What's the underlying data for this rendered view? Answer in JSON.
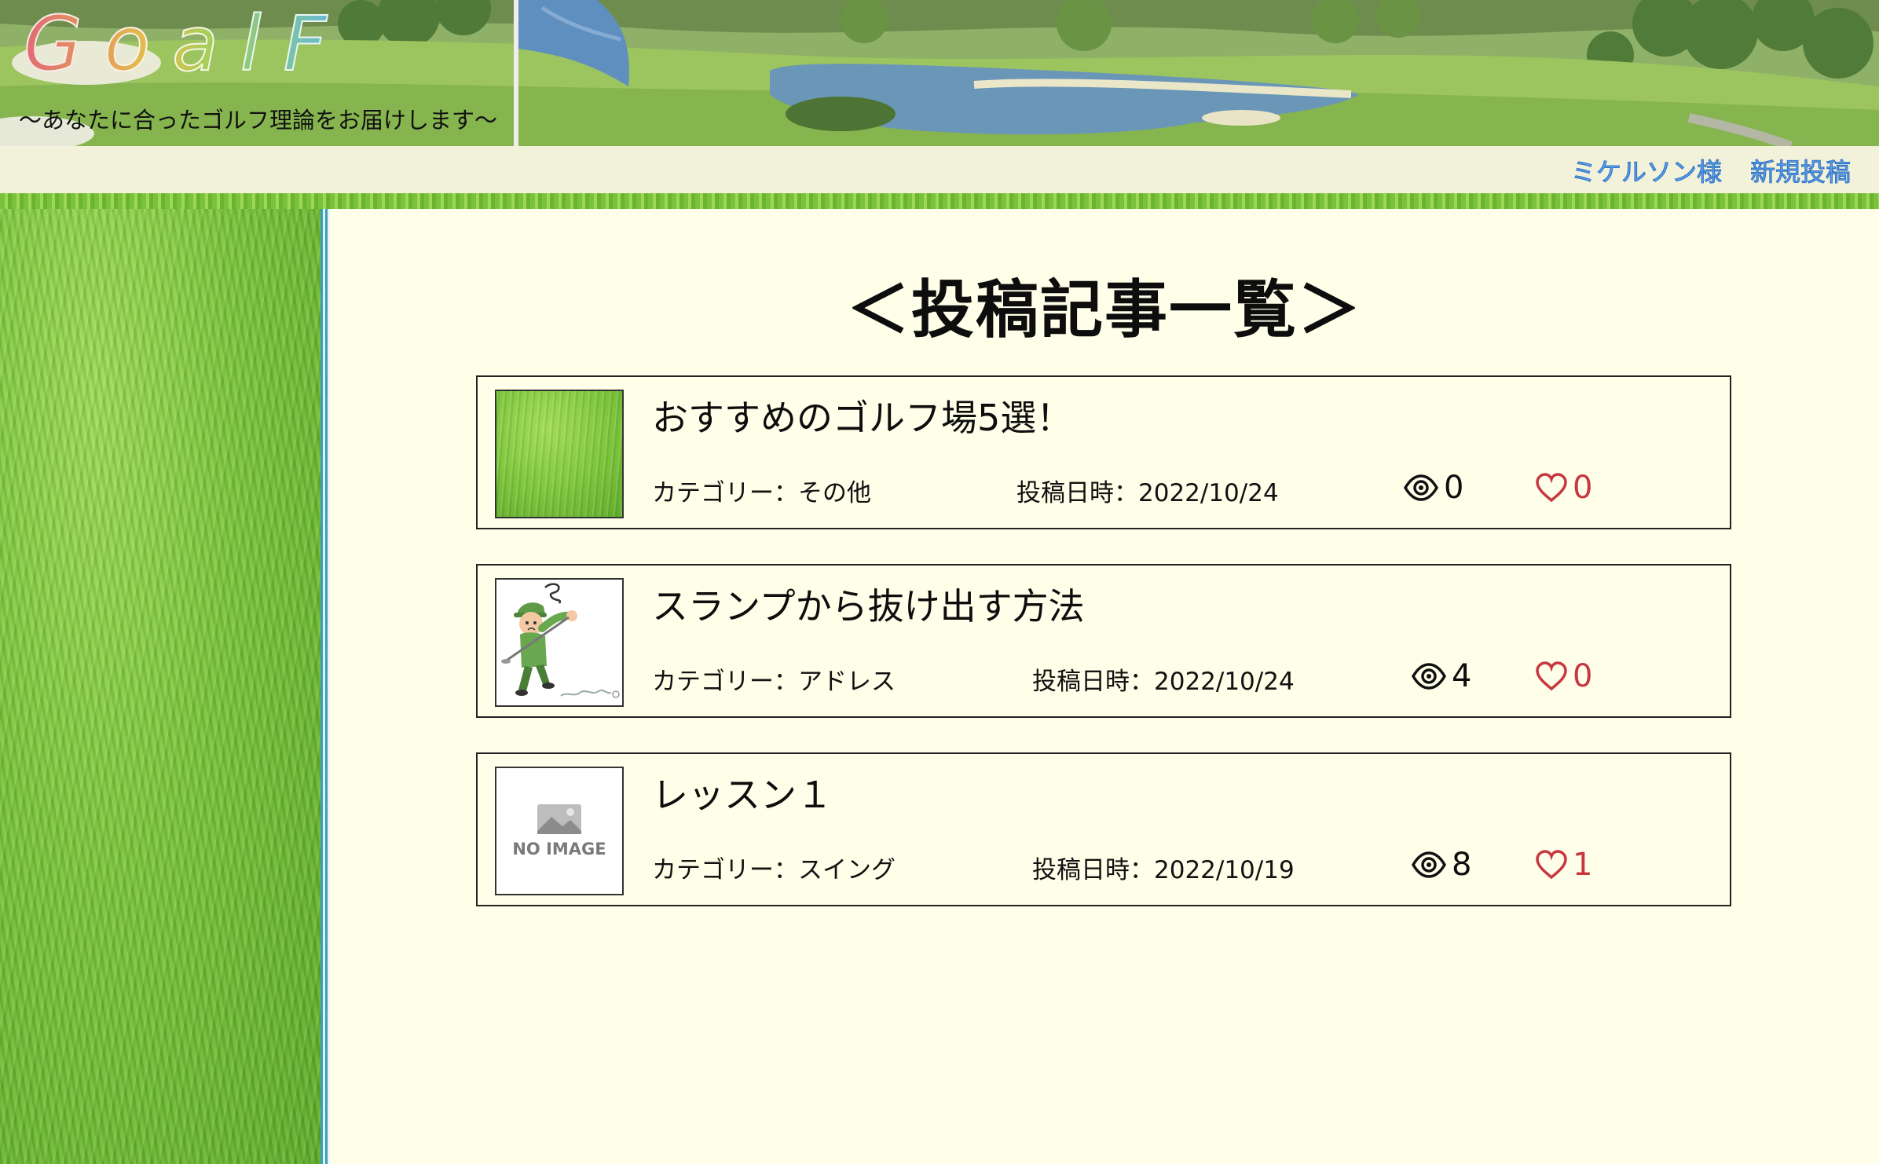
{
  "header": {
    "logo": "GoalF",
    "tagline": "〜あなたに合ったゴルフ理論をお届けします〜"
  },
  "nav": {
    "user_link": "ミケルソン様",
    "new_post_link": "新規投稿"
  },
  "page_title": "＜投稿記事一覧＞",
  "posts": [
    {
      "title": "おすすめのゴルフ場5選！",
      "category": "カテゴリー：その他",
      "date": "投稿日時：2022/10/24",
      "views": "0",
      "likes": "0",
      "thumbnail": "grass-image"
    },
    {
      "title": "スランプから抜け出す方法",
      "category": "カテゴリー：アドレス",
      "date": "投稿日時：2022/10/24",
      "views": "4",
      "likes": "0",
      "thumbnail": "golfer-illustration"
    },
    {
      "title": "レッスン１",
      "category": "カテゴリー：スイング",
      "date": "投稿日時：2022/10/19",
      "views": "8",
      "likes": "1",
      "thumbnail": "no-image-placeholder",
      "thumbnail_text": "NO IMAGE"
    }
  ],
  "colors": {
    "content_bg": "#fefee9",
    "nav_bg": "#f2f1d9",
    "nav_link": "#5aa0ef",
    "like": "#c8363f",
    "divider": "#3d9fb4"
  }
}
